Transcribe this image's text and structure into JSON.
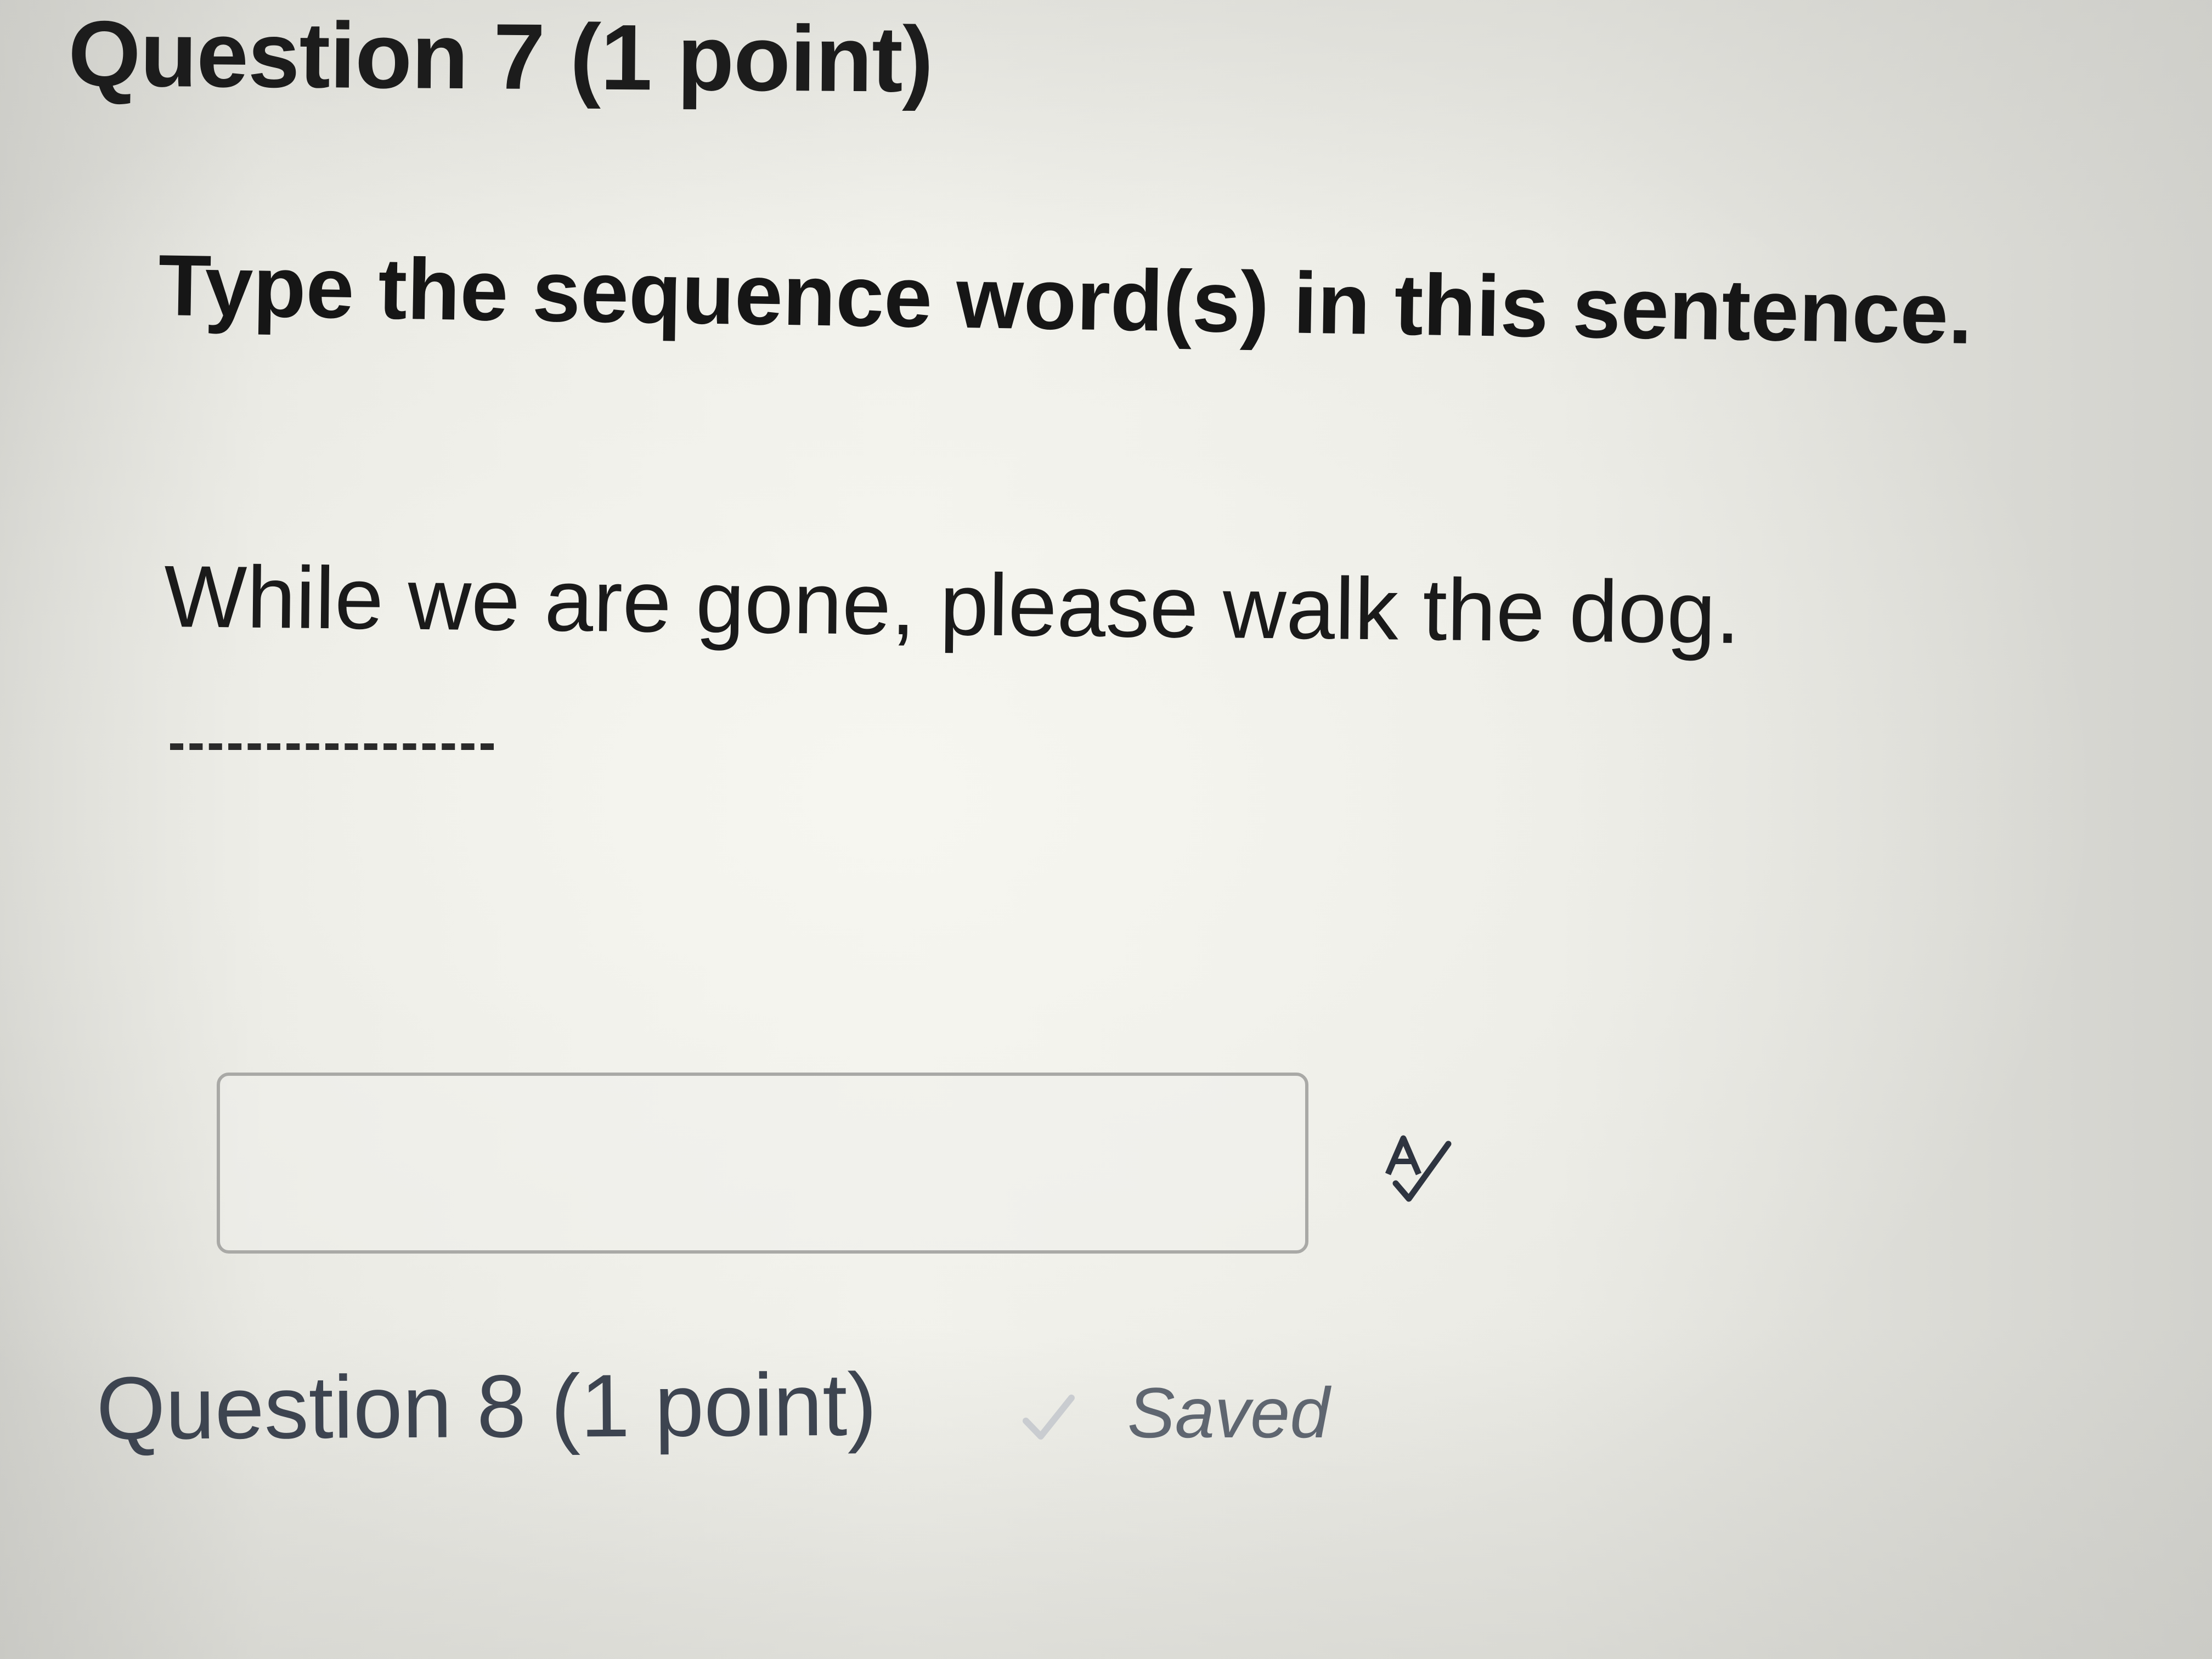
{
  "question7": {
    "title": "Question 7 (1 point)",
    "prompt": "Type the sequence word(s) in this sentence.",
    "sentence": "While we are gone, please walk the dog.",
    "answer": {
      "value": "",
      "placeholder": ""
    },
    "spellcheck_icon": "spellcheck-icon"
  },
  "question8": {
    "title": "Question 8 (1 point)",
    "status_label": "Saved",
    "status_icon": "checkmark-icon"
  },
  "colors": {
    "text_dark": "#1c1c1c",
    "question8_text": "#3d4450",
    "saved_text": "#5f6670",
    "input_border": "#a9a9a6"
  }
}
